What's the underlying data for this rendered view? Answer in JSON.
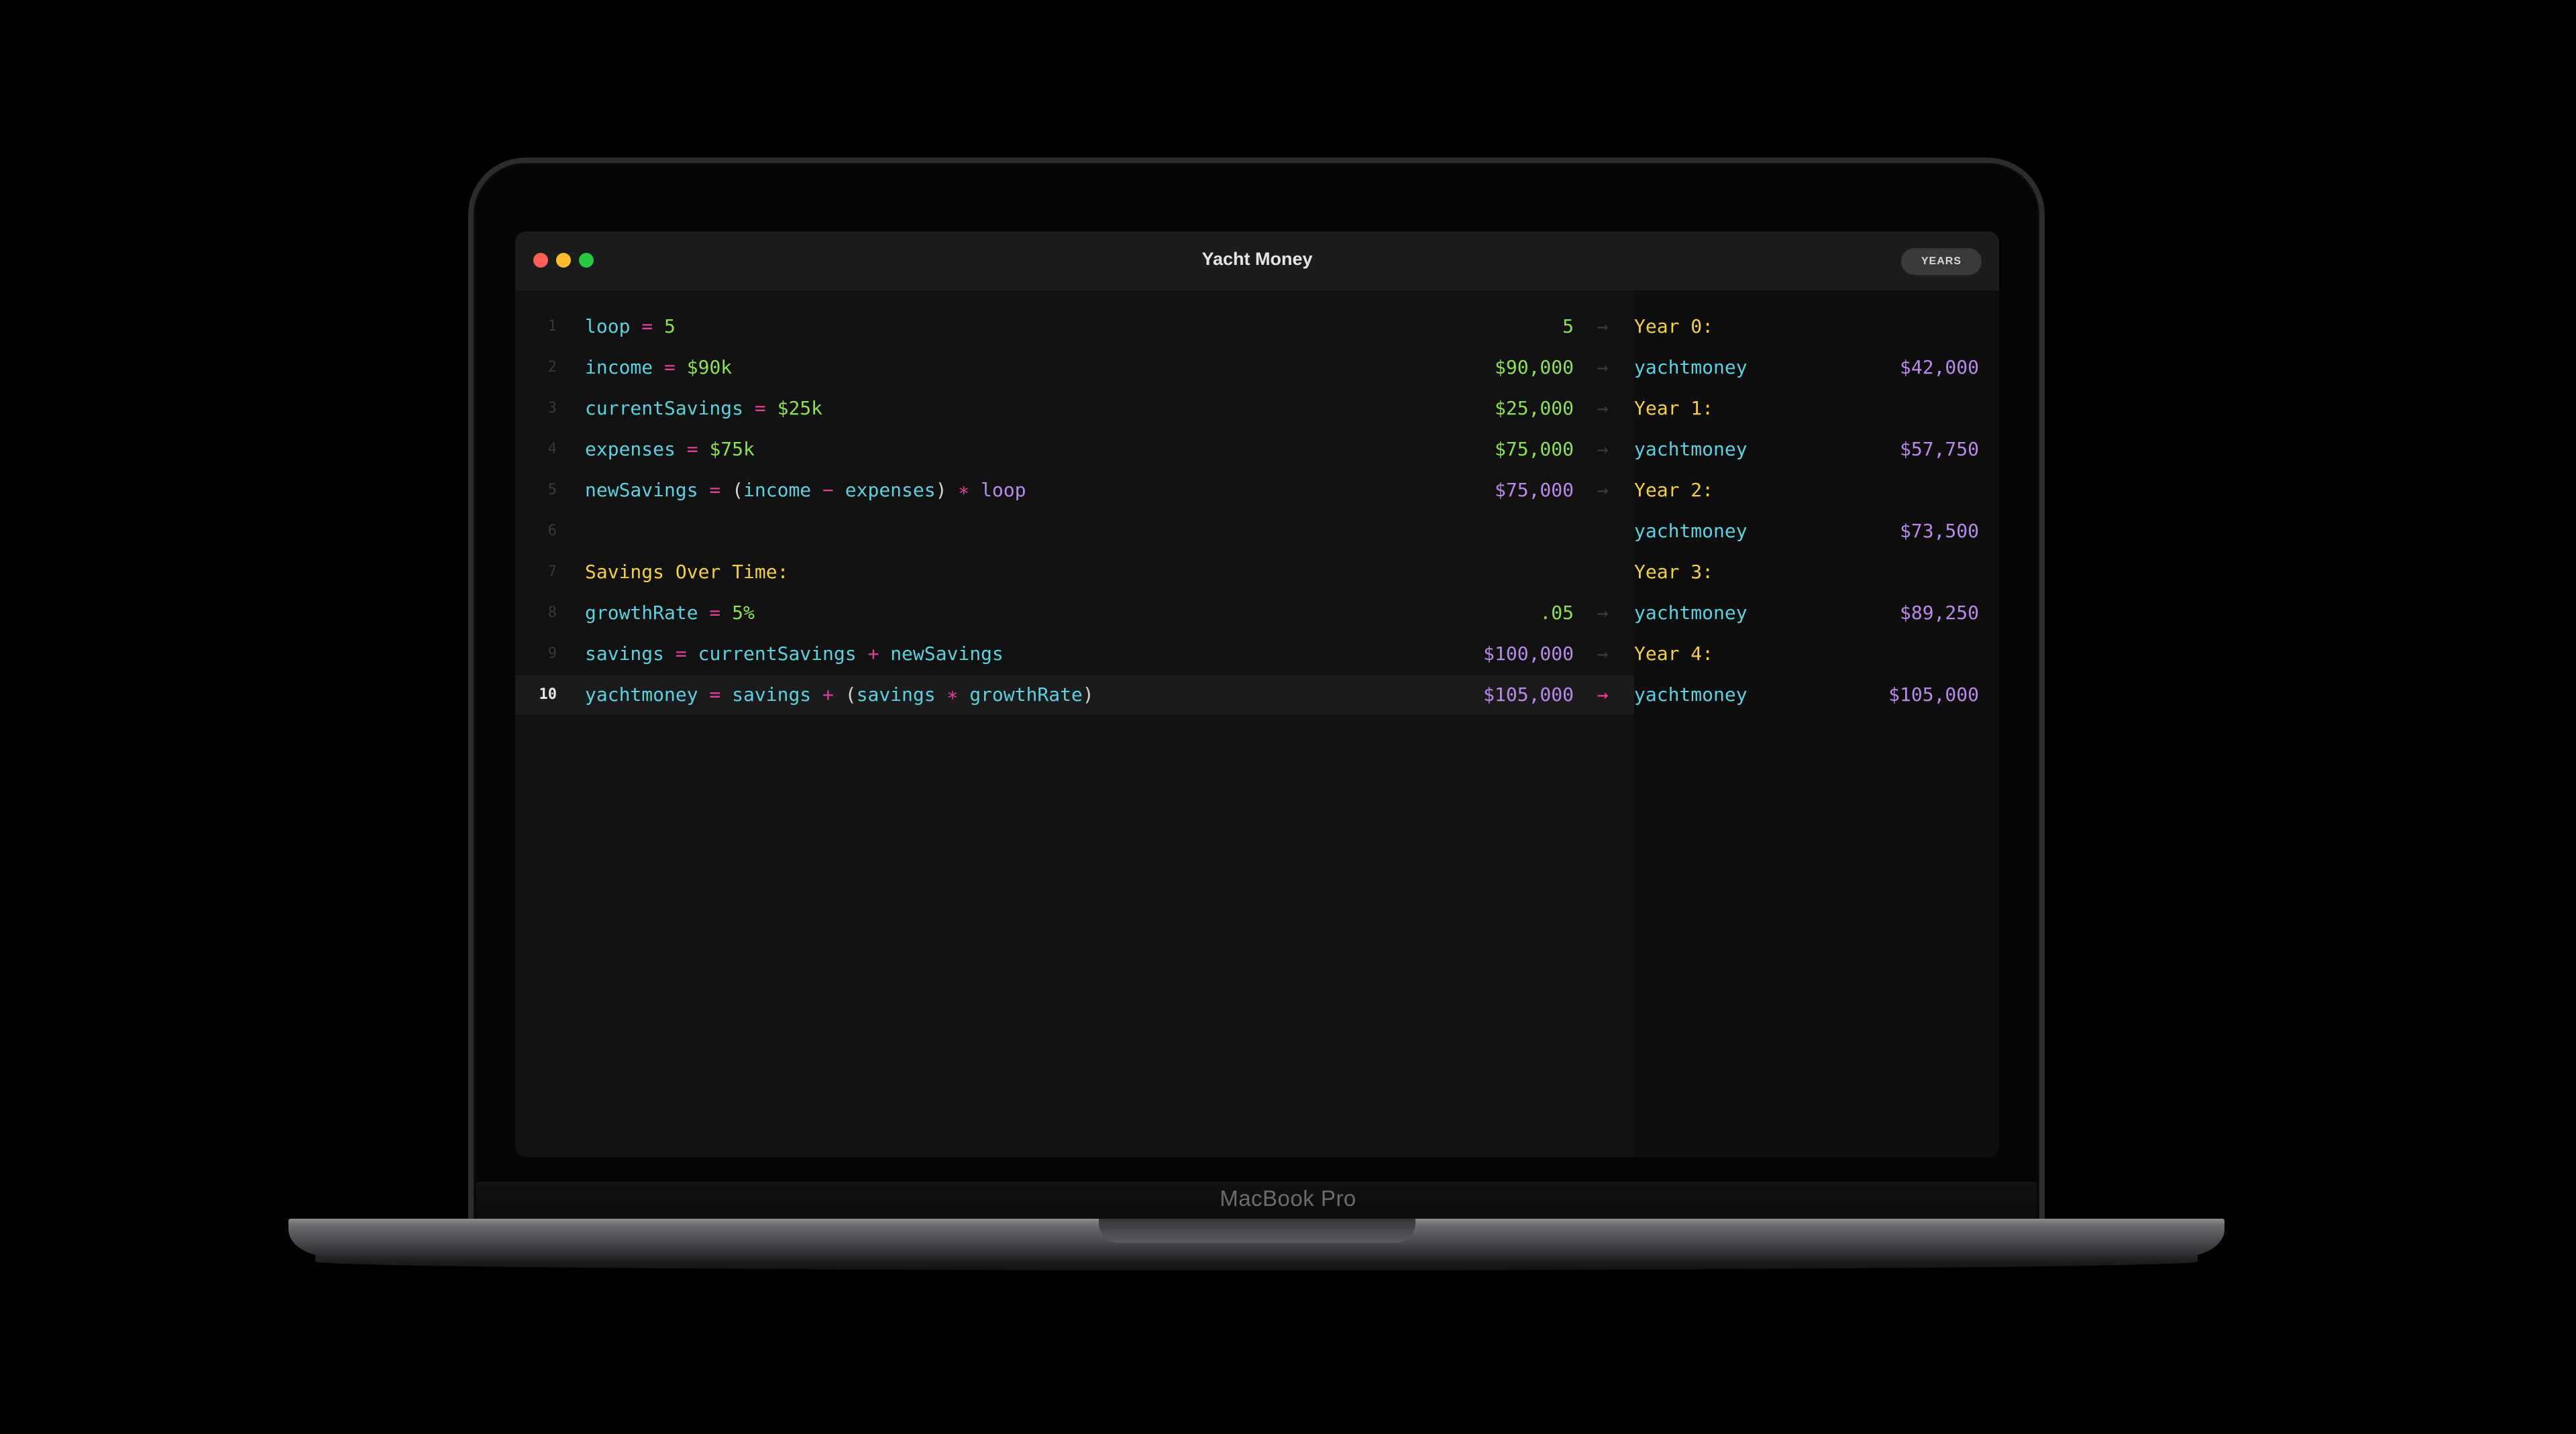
{
  "device": {
    "brand": "MacBook Pro"
  },
  "window": {
    "title": "Yacht Money",
    "mode_button": "YEARS"
  },
  "editor": {
    "lines": [
      {
        "number": "1",
        "tokens": [
          [
            "id",
            "loop"
          ],
          [
            "op",
            " = "
          ],
          [
            "num",
            "5"
          ]
        ],
        "value": "5",
        "value_color": "green"
      },
      {
        "number": "2",
        "tokens": [
          [
            "id",
            "income"
          ],
          [
            "op",
            " = "
          ],
          [
            "num",
            "$90k"
          ]
        ],
        "value": "$90,000",
        "value_color": "green"
      },
      {
        "number": "3",
        "tokens": [
          [
            "id",
            "currentSavings"
          ],
          [
            "op",
            " = "
          ],
          [
            "num",
            "$25k"
          ]
        ],
        "value": "$25,000",
        "value_color": "green"
      },
      {
        "number": "4",
        "tokens": [
          [
            "id",
            "expenses"
          ],
          [
            "op",
            " = "
          ],
          [
            "num",
            "$75k"
          ]
        ],
        "value": "$75,000",
        "value_color": "green"
      },
      {
        "number": "5",
        "tokens": [
          [
            "id",
            "newSavings"
          ],
          [
            "op",
            " = "
          ],
          [
            "paren",
            "("
          ],
          [
            "id",
            "income"
          ],
          [
            "op",
            " − "
          ],
          [
            "id",
            "expenses"
          ],
          [
            "paren",
            ")"
          ],
          [
            "op",
            " ∗ "
          ],
          [
            "val",
            "loop"
          ]
        ],
        "value": "$75,000",
        "value_color": "purple"
      },
      {
        "number": "6",
        "tokens": [],
        "value": ""
      },
      {
        "number": "7",
        "tokens": [
          [
            "head",
            "Savings Over Time:"
          ]
        ],
        "value": ""
      },
      {
        "number": "8",
        "tokens": [
          [
            "id",
            "growthRate"
          ],
          [
            "op",
            " = "
          ],
          [
            "num",
            "5%"
          ]
        ],
        "value": ".05",
        "value_color": "green"
      },
      {
        "number": "9",
        "tokens": [
          [
            "id",
            "savings"
          ],
          [
            "op",
            " = "
          ],
          [
            "id",
            "currentSavings"
          ],
          [
            "op",
            " + "
          ],
          [
            "id",
            "newSavings"
          ]
        ],
        "value": "$100,000",
        "value_color": "purple"
      },
      {
        "number": "10",
        "tokens": [
          [
            "id",
            "yachtmoney"
          ],
          [
            "op",
            " = "
          ],
          [
            "id",
            "savings"
          ],
          [
            "op",
            " + "
          ],
          [
            "paren",
            "("
          ],
          [
            "id",
            "savings"
          ],
          [
            "op",
            " ∗ "
          ],
          [
            "id",
            "growthRate"
          ],
          [
            "paren",
            ")"
          ]
        ],
        "value": "$105,000",
        "value_color": "purple",
        "active": true
      }
    ],
    "arrow_glyph": "→"
  },
  "results": [
    {
      "year": "Year 0:",
      "name": "yachtmoney",
      "value": "$42,000"
    },
    {
      "year": "Year 1:",
      "name": "yachtmoney",
      "value": "$57,750"
    },
    {
      "year": "Year 2:",
      "name": "yachtmoney",
      "value": "$73,500"
    },
    {
      "year": "Year 3:",
      "name": "yachtmoney",
      "value": "$89,250"
    },
    {
      "year": "Year 4:",
      "name": "yachtmoney",
      "value": "$105,000"
    }
  ],
  "colors": {
    "identifier": "#5fd0dd",
    "operator": "#e0409a",
    "number": "#8ee05a",
    "heading": "#f4cf4a",
    "result_value": "#b98be8",
    "active_arrow": "#ff3b9a"
  }
}
